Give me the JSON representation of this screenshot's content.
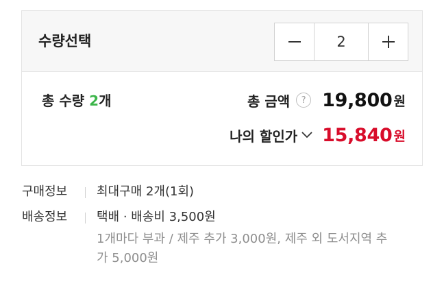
{
  "quantity": {
    "label": "수량선택",
    "value": "2",
    "minus_icon": "minus-icon",
    "plus_icon": "plus-icon"
  },
  "summary": {
    "total_qty_prefix": "총 수량 ",
    "total_qty_number": "2",
    "total_qty_suffix": "개",
    "amount_label": "총 금액",
    "help_icon_glyph": "?",
    "amount_value": "19,800",
    "currency": "원",
    "discount_label": "나의 할인가",
    "discount_value": "15,840",
    "colors": {
      "accent_green": "#3cb54a",
      "discount_red": "#d80c2a"
    }
  },
  "info": {
    "purchase_key": "구매정보",
    "purchase_val": "최대구매 2개(1회)",
    "delivery_key": "배송정보",
    "delivery_val": "택배 · 배송비 3,500원",
    "delivery_sub_1": "1개마다 부과 / 제주 추가 3,000원, 제주 외 도서지역 추",
    "delivery_sub_2": "가 5,000원"
  }
}
